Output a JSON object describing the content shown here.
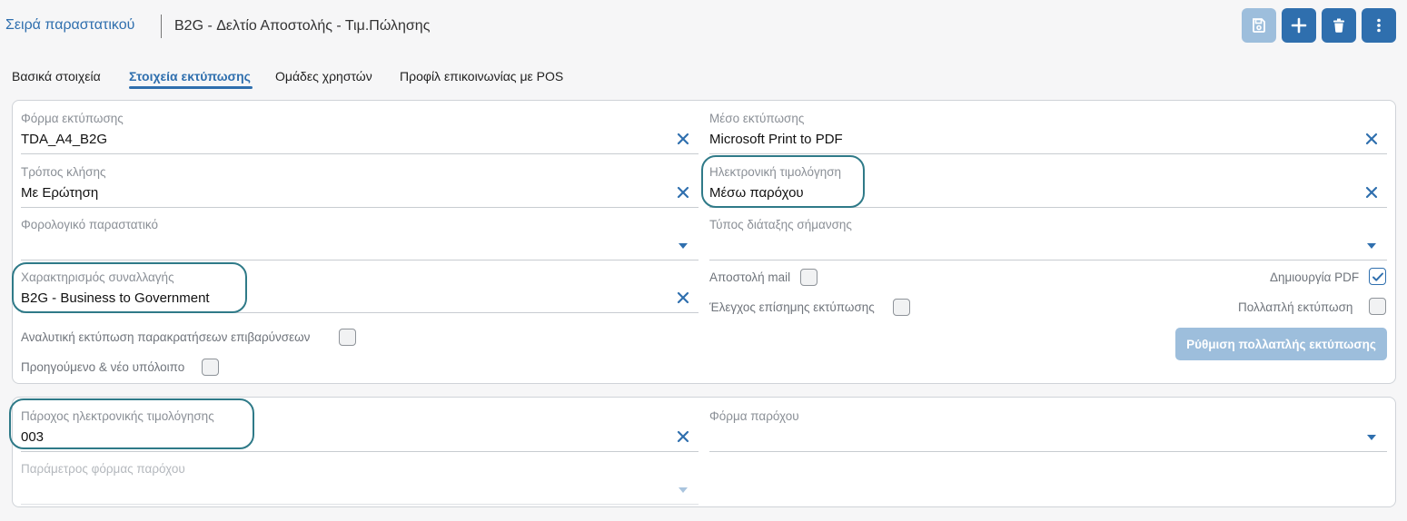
{
  "header": {
    "breadcrumb_link": "Σειρά παραστατικού",
    "title": "B2G - Δελτίο Αποστολής - Τιμ.Πώλησης",
    "toolbar": {
      "save_icon": "save-icon",
      "add_icon": "plus-icon",
      "delete_icon": "trash-icon",
      "more_icon": "more-vertical-icon"
    }
  },
  "tabs": [
    {
      "label": "Βασικά στοιχεία",
      "active": false
    },
    {
      "label": "Στοιχεία εκτύπωσης",
      "active": true
    },
    {
      "label": "Ομάδες χρηστών",
      "active": false
    },
    {
      "label": "Προφίλ επικοινωνίας με POS",
      "active": false
    }
  ],
  "print": {
    "print_form": {
      "label": "Φόρμα εκτύπωσης",
      "value": "TDA_A4_B2G"
    },
    "call_mode": {
      "label": "Τρόπος κλήσης",
      "value": "Με Ερώτηση"
    },
    "tax_document": {
      "label": "Φορολογικό παραστατικό",
      "value": ""
    },
    "transaction_type": {
      "label": "Χαρακτηρισμός συναλλαγής",
      "value": "B2G - Business to Government"
    },
    "print_medium": {
      "label": "Μέσο εκτύπωσης",
      "value": "Microsoft Print to PDF"
    },
    "e_invoicing": {
      "label": "Ηλεκτρονική τιμολόγηση",
      "value": "Μέσω παρόχου"
    },
    "marking_layout": {
      "label": "Τύπος διάταξης σήμανσης",
      "value": ""
    },
    "checkboxes": {
      "detailed_withholdings": {
        "label": "Αναλυτική εκτύπωση παρακρατήσεων επιβαρύνσεων",
        "checked": false
      },
      "prev_new_balance": {
        "label": "Προηγούμενο & νέο υπόλοιπο",
        "checked": false
      },
      "send_mail": {
        "label": "Αποστολή mail",
        "checked": false
      },
      "official_print_check": {
        "label": "Έλεγχος επίσημης εκτύπωσης",
        "checked": false
      },
      "create_pdf": {
        "label": "Δημιουργία PDF",
        "checked": true
      },
      "multiple_print": {
        "label": "Πολλαπλή εκτύπωση",
        "checked": false
      }
    },
    "multi_print_button": "Ρύθμιση πολλαπλής εκτύπωσης"
  },
  "provider": {
    "provider": {
      "label": "Πάροχος ηλεκτρονικής τιμολόγησης",
      "value": "003"
    },
    "provider_form": {
      "label": "Φόρμα παρόχου",
      "value": ""
    },
    "provider_form_param": {
      "label": "Παράμετρος φόρμας παρόχου",
      "value": ""
    }
  },
  "colors": {
    "accent": "#2f6fae",
    "accent_disabled": "#9dbedc",
    "highlight": "#2f7a88"
  }
}
